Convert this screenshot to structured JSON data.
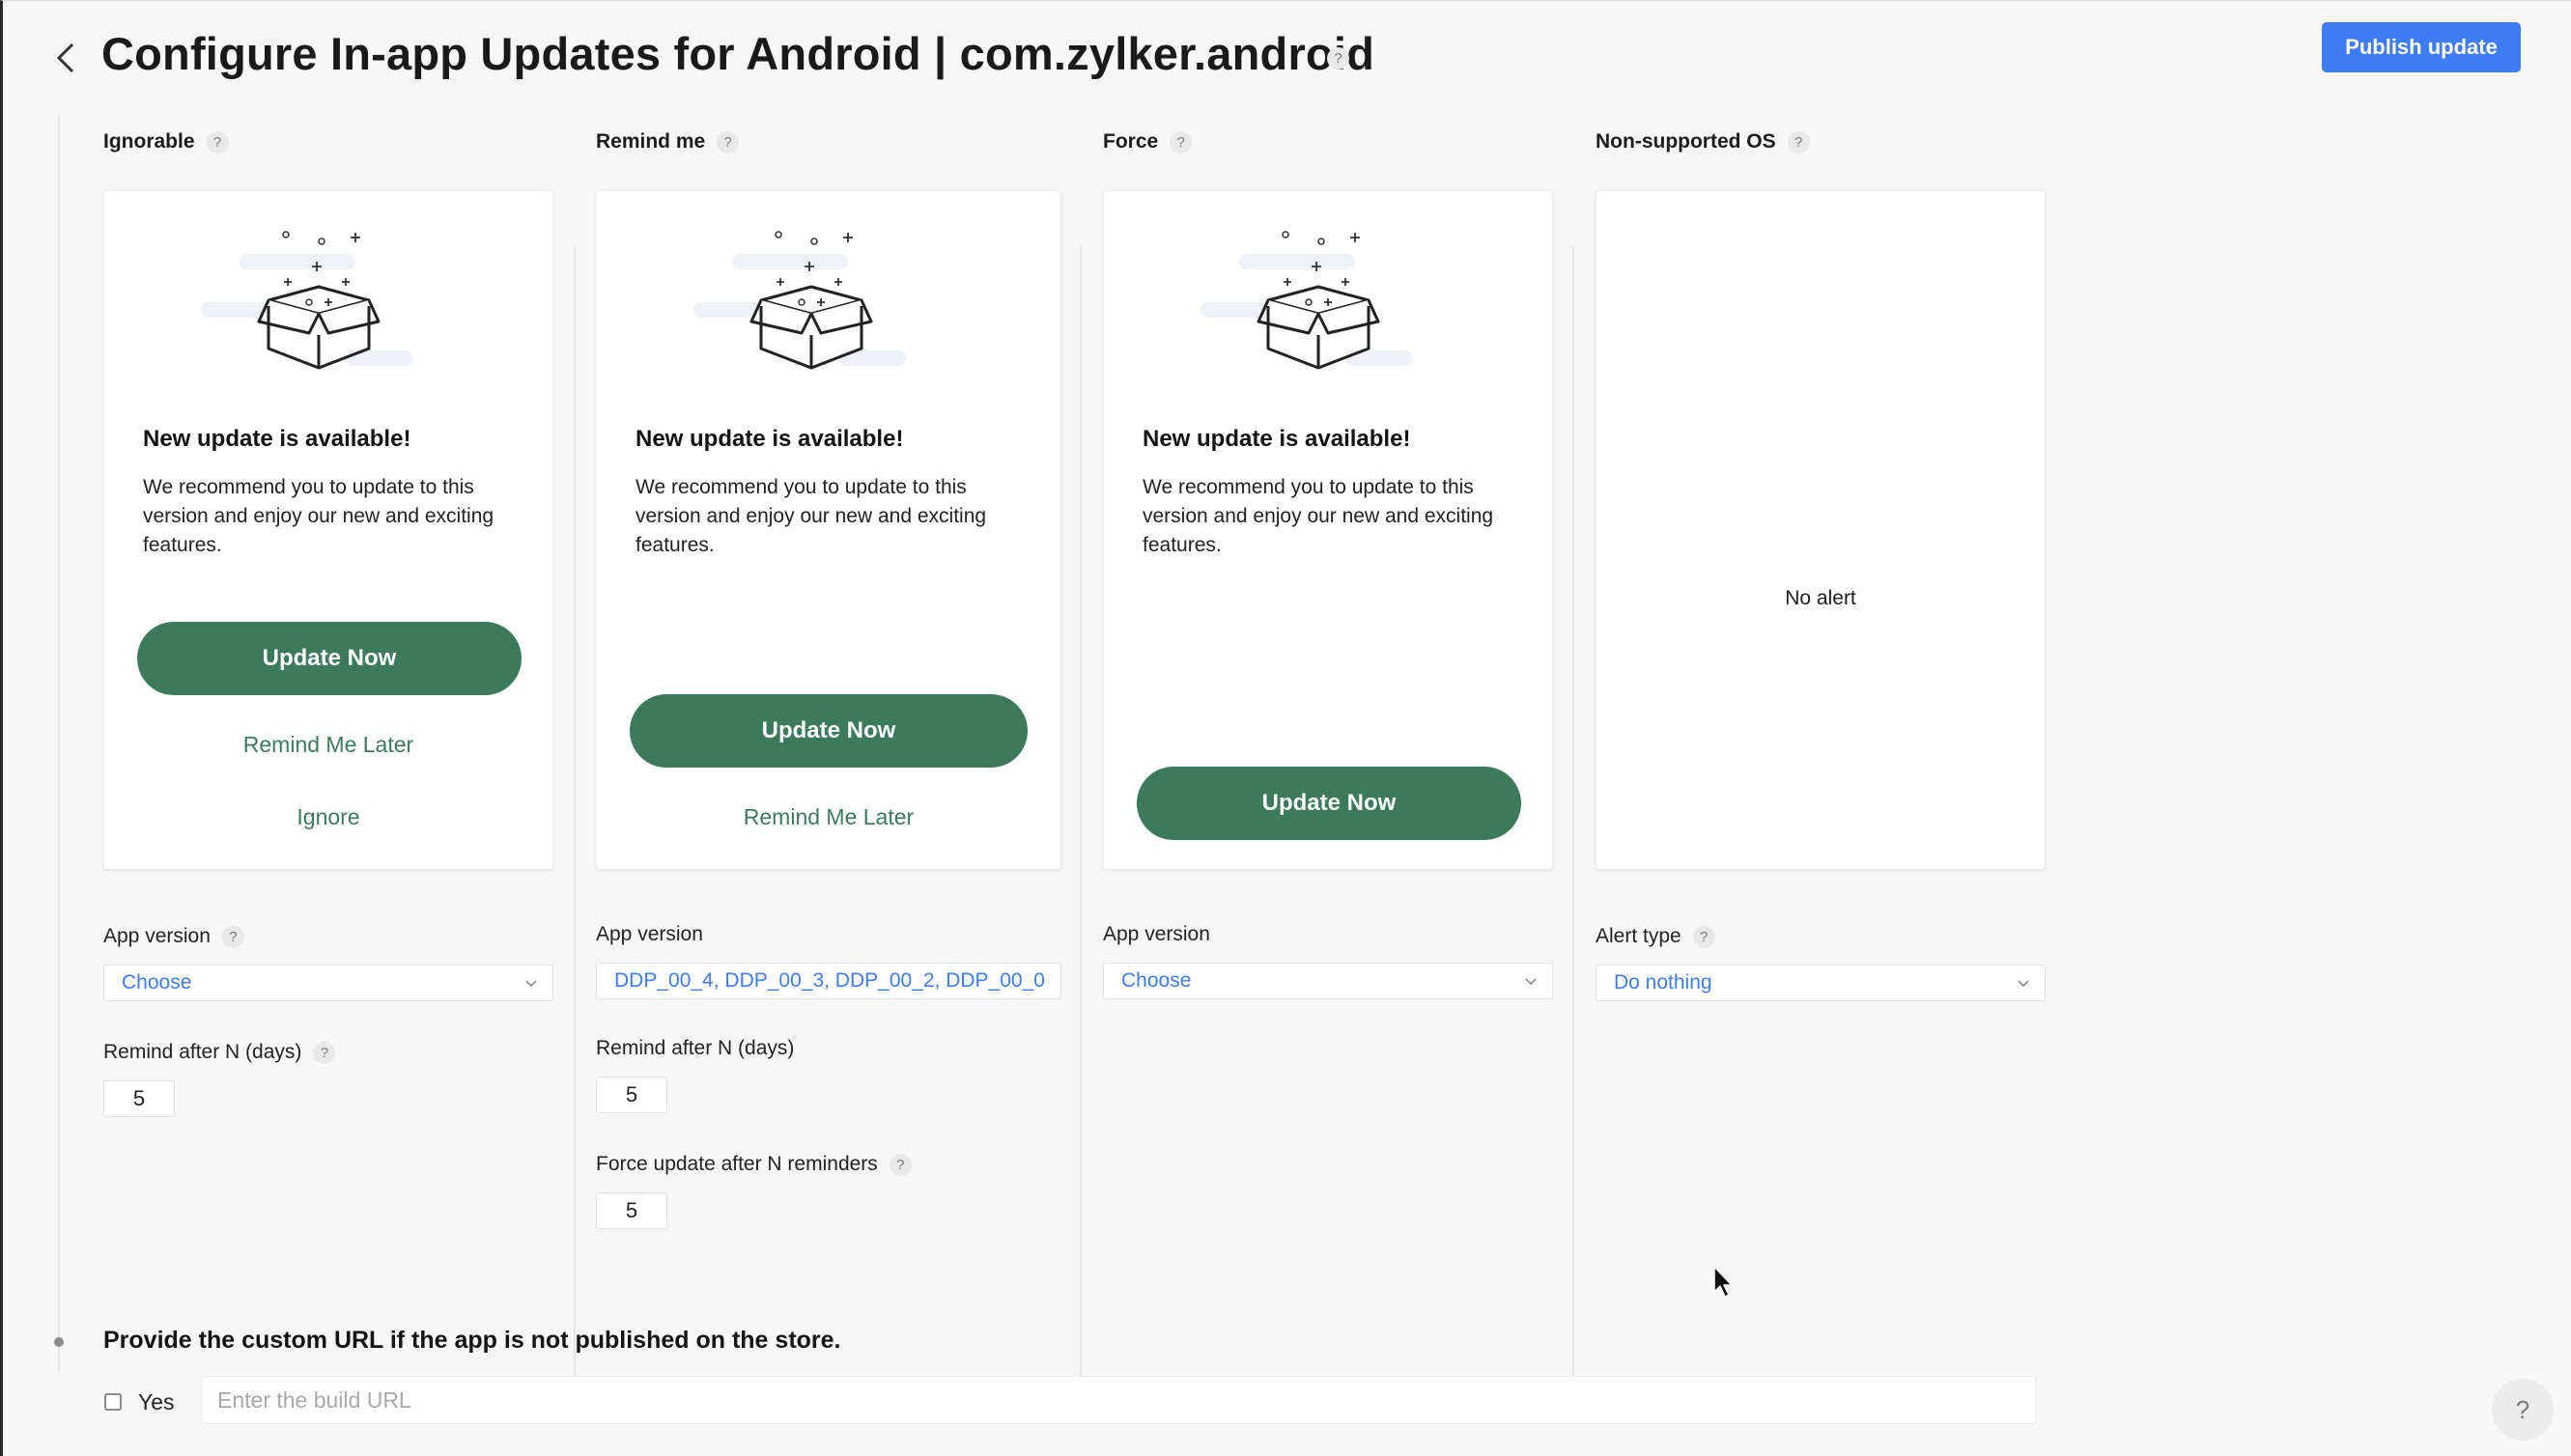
{
  "header": {
    "title": "Configure In-app Updates for Android | com.zylker.android",
    "publish_label": "Publish update",
    "back_icon": "chevron-left-icon"
  },
  "help_glyph": "?",
  "columns": [
    {
      "heading": "Ignorable",
      "card": {
        "title": "New update is available!",
        "body": "We recommend you to update to this version and enjoy our new and exciting features.",
        "update_label": "Update Now",
        "remind_label": "Remind Me Later",
        "ignore_label": "Ignore"
      },
      "app_version_label": "App version",
      "app_version_value": "Choose",
      "remind_label": "Remind after N (days)",
      "remind_value": "5"
    },
    {
      "heading": "Remind me",
      "card": {
        "title": "New update is available!",
        "body": "We recommend you to update to this version and enjoy our new and exciting features.",
        "update_label": "Update Now",
        "remind_label": "Remind Me Later"
      },
      "app_version_label": "App version",
      "app_version_value": "DDP_00_4, DDP_00_3, DDP_00_2, DDP_00_0",
      "remind_label": "Remind after N (days)",
      "remind_value": "5",
      "force_label": "Force update after N reminders",
      "force_value": "5"
    },
    {
      "heading": "Force",
      "card": {
        "title": "New update is available!",
        "body": "We recommend you to update to this version and enjoy our new and exciting features.",
        "update_label": "Update Now"
      },
      "app_version_label": "App version",
      "app_version_value": "Choose"
    },
    {
      "heading": "Non-supported OS",
      "card": {
        "message": "No alert"
      },
      "alert_type_label": "Alert type",
      "alert_type_value": "Do nothing"
    }
  ],
  "custom_url": {
    "title": "Provide the custom URL if the app is not published on the store.",
    "checkbox_label": "Yes",
    "placeholder": "Enter the build URL"
  },
  "colors": {
    "accent": "#3d7cf5",
    "update_green": "#3b7a5d"
  }
}
